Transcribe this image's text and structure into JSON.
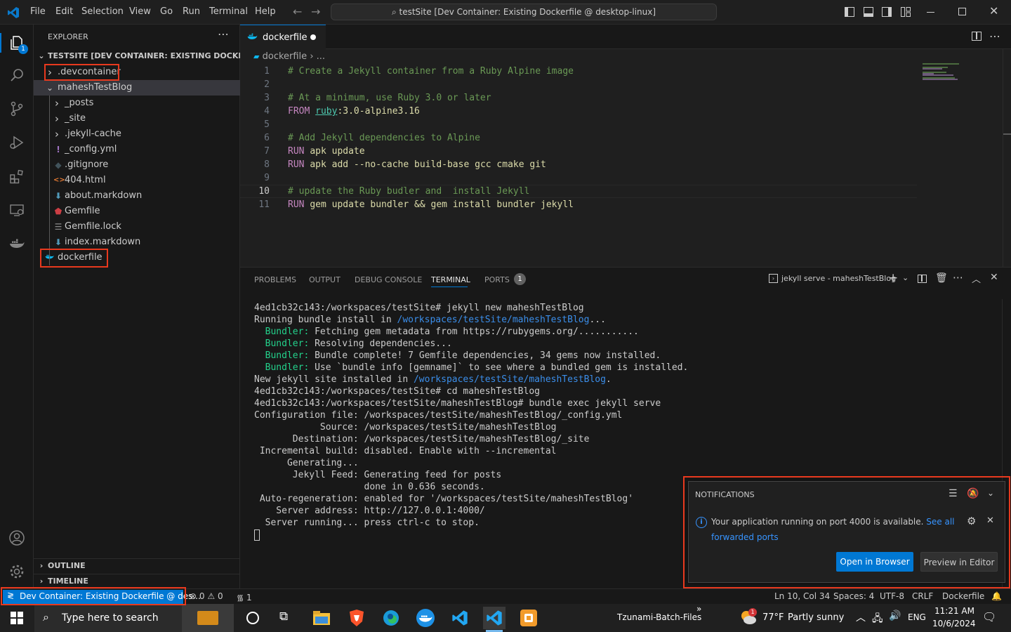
{
  "colors": {
    "accent": "#0078d4",
    "highlight": "#e8391e",
    "remote": "#0078d4"
  },
  "titlebar": {
    "menu": [
      "File",
      "Edit",
      "Selection",
      "View",
      "Go",
      "Run",
      "Terminal",
      "Help"
    ],
    "command_center": "testSite [Dev Container: Existing Dockerfile @ desktop-linux]"
  },
  "activity": {
    "explorer_badge": "1"
  },
  "explorer": {
    "header": "EXPLORER",
    "root": "TESTSITE [DEV CONTAINER: EXISTING DOCKERFIL...",
    "items": [
      {
        "label": ".devcontainer",
        "type": "folder",
        "depth": 1
      },
      {
        "label": "maheshTestBlog",
        "type": "folder-open",
        "depth": 1
      },
      {
        "label": "_posts",
        "type": "folder",
        "depth": 2
      },
      {
        "label": "_site",
        "type": "folder",
        "depth": 2
      },
      {
        "label": ".jekyll-cache",
        "type": "folder",
        "depth": 2
      },
      {
        "label": "_config.yml",
        "type": "yml",
        "depth": 2
      },
      {
        "label": ".gitignore",
        "type": "git",
        "depth": 2
      },
      {
        "label": "404.html",
        "type": "html",
        "depth": 2
      },
      {
        "label": "about.markdown",
        "type": "md",
        "depth": 2
      },
      {
        "label": "Gemfile",
        "type": "gem",
        "depth": 2
      },
      {
        "label": "Gemfile.lock",
        "type": "lock",
        "depth": 2
      },
      {
        "label": "index.markdown",
        "type": "md",
        "depth": 2
      },
      {
        "label": "dockerfile",
        "type": "docker",
        "depth": 1
      }
    ],
    "outline": "OUTLINE",
    "timeline": "TIMELINE"
  },
  "editor": {
    "tab_label": "dockerfile",
    "breadcrumb": [
      "dockerfile",
      "..."
    ],
    "lines": [
      {
        "n": "1",
        "parts": [
          [
            "com",
            "# Create a Jekyll container from a Ruby Alpine image"
          ]
        ]
      },
      {
        "n": "2",
        "parts": []
      },
      {
        "n": "3",
        "parts": [
          [
            "com",
            "# At a minimum, use Ruby 3.0 or later"
          ]
        ]
      },
      {
        "n": "4",
        "parts": [
          [
            "kw",
            "FROM "
          ],
          [
            "im",
            "ruby"
          ],
          [
            "fn",
            ":3.0-alpine3.16"
          ]
        ]
      },
      {
        "n": "5",
        "parts": []
      },
      {
        "n": "6",
        "parts": [
          [
            "com",
            "# Add Jekyll dependencies to Alpine"
          ]
        ]
      },
      {
        "n": "7",
        "parts": [
          [
            "kw",
            "RUN "
          ],
          [
            "fn",
            "apk update"
          ]
        ]
      },
      {
        "n": "8",
        "parts": [
          [
            "kw",
            "RUN "
          ],
          [
            "fn",
            "apk add --no-cache build-base gcc cmake git"
          ]
        ]
      },
      {
        "n": "9",
        "parts": []
      },
      {
        "n": "10",
        "parts": [
          [
            "com",
            "# update the Ruby budler and  install Jekyll"
          ]
        ]
      },
      {
        "n": "11",
        "parts": [
          [
            "kw",
            "RUN "
          ],
          [
            "fn",
            "gem update bundler && gem install bundler jekyll"
          ]
        ]
      }
    ]
  },
  "panel": {
    "tabs": [
      "PROBLEMS",
      "OUTPUT",
      "DEBUG CONSOLE",
      "TERMINAL",
      "PORTS"
    ],
    "ports_badge": "1",
    "terminal_name": "jekyll serve - maheshTestBlog",
    "terminal": [
      [
        [
          "",
          "4ed1cb32c143:/workspaces/testSite# jekyll new maheshTestBlog"
        ]
      ],
      [
        [
          "",
          "Running bundle install in "
        ],
        [
          "link",
          "/workspaces/testSite/maheshTestBlog"
        ],
        [
          "",
          "..."
        ]
      ],
      [
        [
          "green",
          "  Bundler:"
        ],
        [
          "",
          " Fetching gem metadata from https://rubygems.org/..........."
        ]
      ],
      [
        [
          "green",
          "  Bundler:"
        ],
        [
          "",
          " Resolving dependencies..."
        ]
      ],
      [
        [
          "green",
          "  Bundler:"
        ],
        [
          "",
          " Bundle complete! 7 Gemfile dependencies, 34 gems now installed."
        ]
      ],
      [
        [
          "green",
          "  Bundler:"
        ],
        [
          "",
          " Use `bundle info [gemname]` to see where a bundled gem is installed."
        ]
      ],
      [
        [
          "",
          "New jekyll site installed in "
        ],
        [
          "link",
          "/workspaces/testSite/maheshTestBlog"
        ],
        [
          "",
          "."
        ]
      ],
      [
        [
          "",
          "4ed1cb32c143:/workspaces/testSite# cd maheshTestBlog"
        ]
      ],
      [
        [
          "",
          "4ed1cb32c143:/workspaces/testSite/maheshTestBlog# bundle exec jekyll serve"
        ]
      ],
      [
        [
          "",
          "Configuration file: /workspaces/testSite/maheshTestBlog/_config.yml"
        ]
      ],
      [
        [
          "",
          "            Source: /workspaces/testSite/maheshTestBlog"
        ]
      ],
      [
        [
          "",
          "       Destination: /workspaces/testSite/maheshTestBlog/_site"
        ]
      ],
      [
        [
          "",
          " Incremental build: disabled. Enable with --incremental"
        ]
      ],
      [
        [
          "",
          "      Generating..."
        ]
      ],
      [
        [
          "",
          "       Jekyll Feed: Generating feed for posts"
        ]
      ],
      [
        [
          "",
          "                    done in 0.636 seconds."
        ]
      ],
      [
        [
          "",
          " Auto-regeneration: enabled for '/workspaces/testSite/maheshTestBlog'"
        ]
      ],
      [
        [
          "",
          "    Server address: http://127.0.0.1:4000/"
        ]
      ],
      [
        [
          "",
          "  Server running... press ctrl-c to stop."
        ]
      ]
    ]
  },
  "notification": {
    "header": "NOTIFICATIONS",
    "message": "Your application running on port 4000 is available.",
    "link": "See all",
    "link2": "forwarded ports",
    "primary_button": "Open in Browser",
    "secondary_button": "Preview in Editor"
  },
  "statusbar": {
    "remote": "Dev Container: Existing Dockerfile @ des...",
    "errors": "0",
    "warnings": "0",
    "ports": "1",
    "position": "Ln 10, Col 34",
    "spaces": "Spaces: 4",
    "encoding": "UTF-8",
    "eol": "CRLF",
    "language": "Dockerfile"
  },
  "taskbar": {
    "search_placeholder": "Type here to search",
    "running_app": "Tzunami-Batch-Files",
    "weather_temp": "77°F",
    "weather_text": "Partly sunny",
    "weather_badge": "1",
    "lang": "ENG",
    "time": "11:21 AM",
    "date": "10/6/2024"
  }
}
